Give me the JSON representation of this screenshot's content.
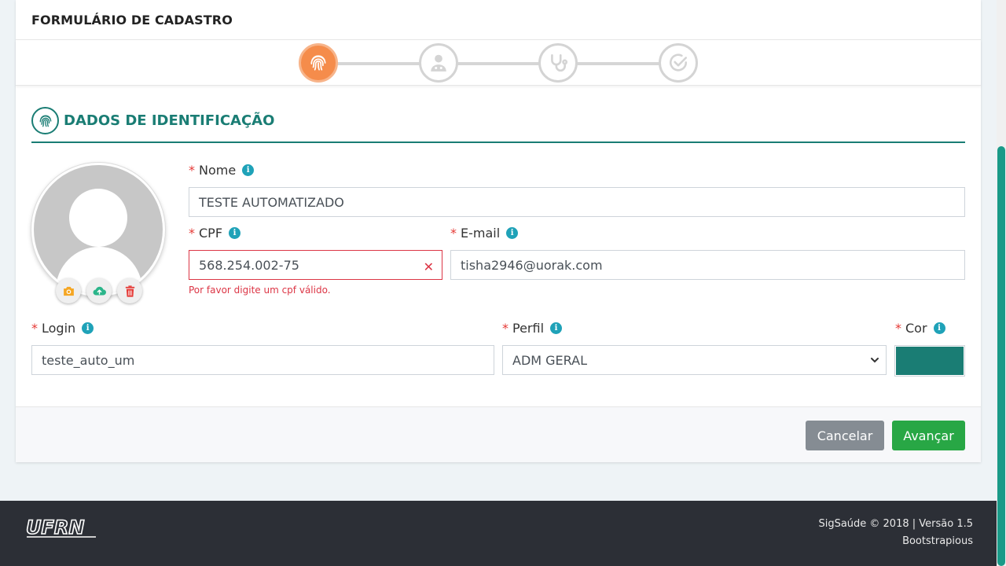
{
  "form": {
    "title": "FORMULÁRIO DE CADASTRO"
  },
  "stepper": {
    "steps": [
      {
        "icon": "fingerprint-icon",
        "state": "active"
      },
      {
        "icon": "user-doctor-icon",
        "state": "pending"
      },
      {
        "icon": "stethoscope-icon",
        "state": "pending"
      },
      {
        "icon": "check-circle-icon",
        "state": "pending"
      }
    ]
  },
  "section": {
    "title": "DADOS DE IDENTIFICAÇÃO",
    "icon": "fingerprint-icon"
  },
  "avatar": {
    "buttons": [
      "camera-icon",
      "cloud-upload-icon",
      "trash-icon"
    ]
  },
  "fields": {
    "nome": {
      "required_mark": "*",
      "label": "Nome",
      "value": "TESTE AUTOMATIZADO"
    },
    "cpf": {
      "required_mark": "*",
      "label": "CPF",
      "value": "568.254.002-75",
      "error": "Por favor digite um cpf válido."
    },
    "email": {
      "required_mark": "*",
      "label": "E-mail",
      "value": "tisha2946@uorak.com"
    },
    "login": {
      "required_mark": "*",
      "label": "Login",
      "value": "teste_auto_um"
    },
    "perfil": {
      "required_mark": "*",
      "label": "Perfil",
      "value": "ADM GERAL"
    },
    "cor": {
      "required_mark": "*",
      "label": "Cor",
      "value": "#1a7d74"
    }
  },
  "info_glyph": "i",
  "actions": {
    "cancel": "Cancelar",
    "next": "Avançar"
  },
  "footer": {
    "logo": "UFRN",
    "version": "SigSaúde © 2018 | Versão 1.5",
    "credit": "Bootstrapious"
  },
  "colors": {
    "primary": "#1a7d74",
    "active_step": "#f58c4b",
    "error": "#dc3545",
    "success": "#28a745"
  }
}
